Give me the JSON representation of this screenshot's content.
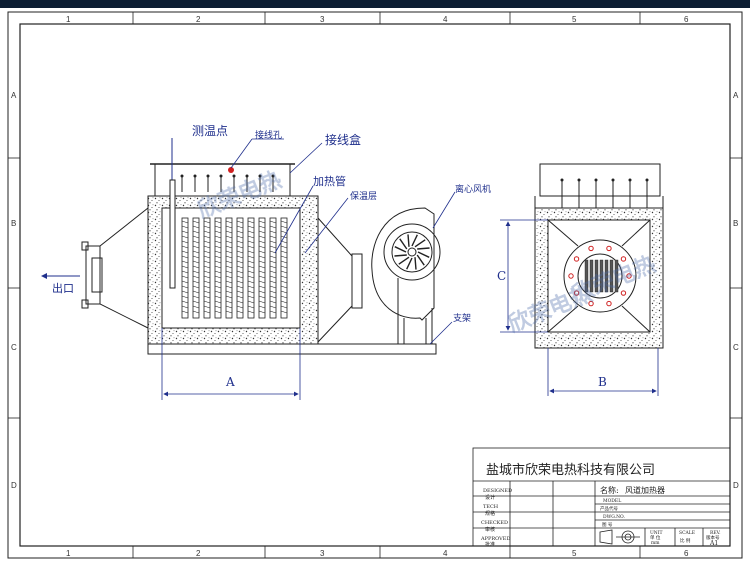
{
  "zones": {
    "cols": [
      "1",
      "2",
      "3",
      "4",
      "5",
      "6"
    ],
    "rows": [
      "A",
      "B",
      "C",
      "D"
    ]
  },
  "labels": {
    "temp_point": "测温点",
    "wiring_hole": "接线孔",
    "junction_box": "接线盒",
    "heating_tube": "加热管",
    "insulation": "保温层",
    "fan": "离心风机",
    "outlet": "出口",
    "support": "支架",
    "dim_a": "A",
    "dim_b": "B",
    "dim_c": "C"
  },
  "watermark": "欣荣电热",
  "title_block": {
    "company": "盐城市欣荣电热科技有限公司",
    "designed_en": "DESIGNED",
    "designed_cn": "设计",
    "tech_en": "TECH",
    "tech_cn": "规格",
    "checked_en": "CHECKED",
    "checked_cn": "审核",
    "approved_en": "APPROVED",
    "approved_cn": "批准",
    "name_label": "名称:",
    "name_value": "风道加热器",
    "model_en": "MODEL",
    "model_cn": "产品代号",
    "dwg_en": "DWG.NO.",
    "dwg_cn": "图 号",
    "unit_en": "UNIT",
    "unit_cn": "单 位",
    "unit_value": "mm",
    "scale_en": "SCALE",
    "scale_cn": "比 例",
    "rev_en": "REV.",
    "rev_cn": "版本号",
    "rev_value": "A1"
  },
  "colors": {
    "line": "#222222",
    "label": "#1f2f8c",
    "dim": "#1f2f8c",
    "wiring_dot": "#d02020",
    "flange_bolt": "#d02020",
    "frame_bg": "#0c1e33"
  }
}
